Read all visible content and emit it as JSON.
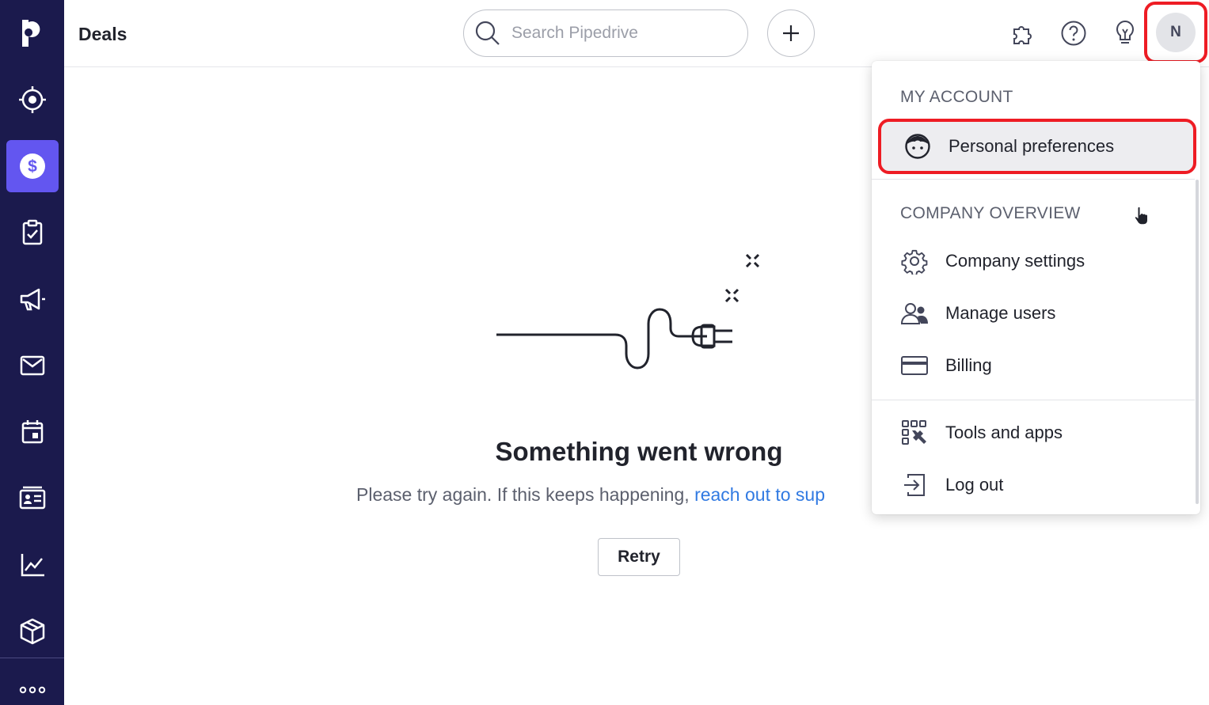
{
  "app": {
    "name": "Pipedrive",
    "logo_letter": "p"
  },
  "colors": {
    "sidebar": "#1b1a4d",
    "active": "#6356f0",
    "link": "#317ae2",
    "highlight": "#ee1c24"
  },
  "sidebar": {
    "items": [
      {
        "name": "leads",
        "icon": "target-icon"
      },
      {
        "name": "deals",
        "icon": "dollar-icon",
        "active": true
      },
      {
        "name": "projects",
        "icon": "clipboard-check-icon"
      },
      {
        "name": "campaigns",
        "icon": "megaphone-icon"
      },
      {
        "name": "mail",
        "icon": "mail-icon"
      },
      {
        "name": "activities",
        "icon": "calendar-icon"
      },
      {
        "name": "contacts",
        "icon": "contact-card-icon"
      },
      {
        "name": "insights",
        "icon": "chart-icon"
      },
      {
        "name": "products",
        "icon": "box-icon"
      }
    ],
    "more_icon": "more-dots-icon"
  },
  "header": {
    "title": "Deals",
    "search_placeholder": "Search Pipedrive",
    "avatar_initial": "N"
  },
  "error": {
    "title": "Something went wrong",
    "desc_prefix": "Please try again. If this keeps happening, ",
    "desc_link": "reach out to sup",
    "retry_label": "Retry"
  },
  "menu": {
    "section_account": "MY ACCOUNT",
    "section_company": "COMPANY OVERVIEW",
    "items": {
      "personal": "Personal preferences",
      "company_settings": "Company settings",
      "manage_users": "Manage users",
      "billing": "Billing",
      "tools": "Tools and apps",
      "logout": "Log out"
    }
  }
}
